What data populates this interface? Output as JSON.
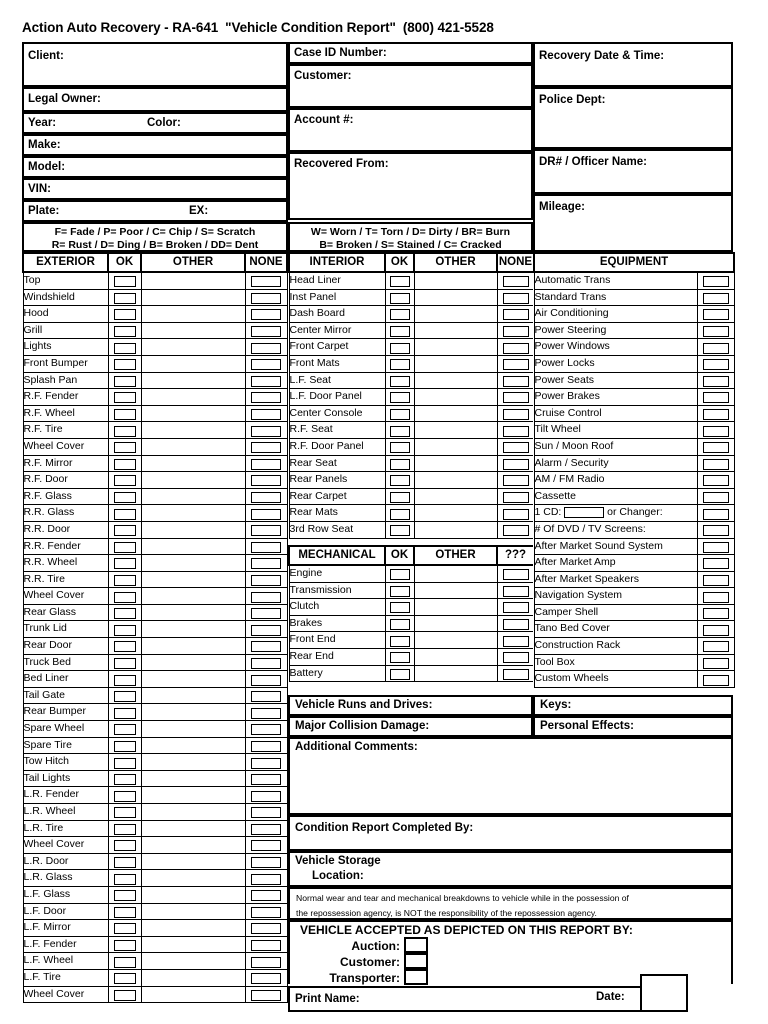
{
  "header": {
    "company": "Action Auto Recovery - RA-641",
    "doc_title": "\"Vehicle Condition Report\"",
    "phone": "(800) 421-5528"
  },
  "client_block": {
    "client": "Client:",
    "legal_owner": "Legal Owner:",
    "year": "Year:",
    "color": "Color:",
    "make": "Make:",
    "model": "Model:",
    "vin": "VIN:",
    "plate": "Plate:",
    "ex": "EX:"
  },
  "case_block": {
    "case_id": "Case ID Number:",
    "customer": "Customer:",
    "account": "Account #:",
    "recovered_from": "Recovered From:"
  },
  "recovery_block": {
    "recovery_date": "Recovery Date & Time:",
    "police_dept": "Police Dept:",
    "dr_officer": "DR# / Officer Name:",
    "mileage": "Mileage:"
  },
  "legends": {
    "exterior_line1": "F= Fade / P= Poor / C= Chip / S= Scratch",
    "exterior_line2": "R= Rust / D= Ding / B= Broken / DD= Dent",
    "interior_line1": "W= Worn / T= Torn / D= Dirty / BR= Burn",
    "interior_line2": "B= Broken / S= Stained / C= Cracked"
  },
  "exterior": {
    "headers": [
      "EXTERIOR",
      "OK",
      "OTHER",
      "NONE"
    ],
    "items": [
      "Top",
      "Windshield",
      "Hood",
      "Grill",
      "Lights",
      "Front Bumper",
      "Splash Pan",
      "R.F. Fender",
      "R.F. Wheel",
      "R.F. Tire",
      "Wheel Cover",
      "R.F. Mirror",
      "R.F. Door",
      "R.F. Glass",
      "R.R. Glass",
      "R.R. Door",
      "R.R. Fender",
      "R.R. Wheel",
      "R.R. Tire",
      "Wheel Cover",
      "Rear Glass",
      "Trunk Lid",
      "Rear Door",
      "Truck Bed",
      "Bed Liner",
      "Tail Gate",
      "Rear Bumper",
      "Spare Wheel",
      "Spare Tire",
      "Tow Hitch",
      "Tail Lights",
      "L.R. Fender",
      "L.R. Wheel",
      "L.R. Tire",
      "Wheel Cover",
      "L.R. Door",
      "L.R. Glass",
      "L.F. Glass",
      "L.F. Door",
      "L.F. Mirror",
      "L.F. Fender",
      "L.F. Wheel",
      "L.F. Tire",
      "Wheel Cover"
    ]
  },
  "interior": {
    "headers": [
      "INTERIOR",
      "OK",
      "OTHER",
      "NONE"
    ],
    "items": [
      "Head Liner",
      "Inst Panel",
      "Dash Board",
      "Center Mirror",
      "Front Carpet",
      "Front Mats",
      "L.F. Seat",
      "L.F. Door Panel",
      "Center Console",
      "R.F. Seat",
      "R.F. Door Panel",
      "Rear Seat",
      "Rear Panels",
      "Rear Carpet",
      "Rear Mats",
      "3rd Row Seat"
    ]
  },
  "mechanical": {
    "headers": [
      "MECHANICAL",
      "OK",
      "OTHER",
      "???"
    ],
    "items": [
      "Engine",
      "Transmission",
      "Clutch",
      "Brakes",
      "Front End",
      "Rear End",
      "Battery"
    ]
  },
  "equipment": {
    "header": "EQUIPMENT",
    "items": [
      "Automatic Trans",
      "Standard Trans",
      "Air Conditioning",
      "Power Steering",
      "Power Windows",
      "Power Locks",
      "Power Seats",
      "Power Brakes",
      "Cruise Control",
      "Tilt Wheel",
      "Sun / Moon Roof",
      "Alarm / Security",
      "AM / FM Radio",
      "Cassette"
    ],
    "cd_label": "1 CD:",
    "cd_or": "or  Changer:",
    "dvd_label": "# Of  DVD  /  TV Screens:",
    "items_after": [
      "After Market Sound System",
      "After Market Amp",
      "After Market Speakers",
      "Navigation System",
      "Camper Shell",
      "Tano Bed Cover",
      "Construction Rack",
      "Tool Box",
      "Custom Wheels"
    ]
  },
  "bottom": {
    "runs_and_drives": "Vehicle Runs and Drives:",
    "keys": "Keys:",
    "major_collision": "Major Collision Damage:",
    "personal_effects": "Personal Effects:",
    "additional_comments": "Additional Comments:",
    "completed_by": "Condition Report Completed By:",
    "vehicle_storage": "Vehicle Storage",
    "location": "Location:",
    "disclaimer_line1": "Normal wear and tear and mechanical breakdowns to vehicle while in the possession of",
    "disclaimer_line2": "the repossession agency, is NOT the responsibility of the repossession agency.",
    "accepted_title": "VEHICLE ACCEPTED AS DEPICTED ON THIS REPORT BY:",
    "auction": "Auction:",
    "customer": "Customer:",
    "transporter": "Transporter:",
    "print_name": "Print Name:",
    "date": "Date:"
  }
}
